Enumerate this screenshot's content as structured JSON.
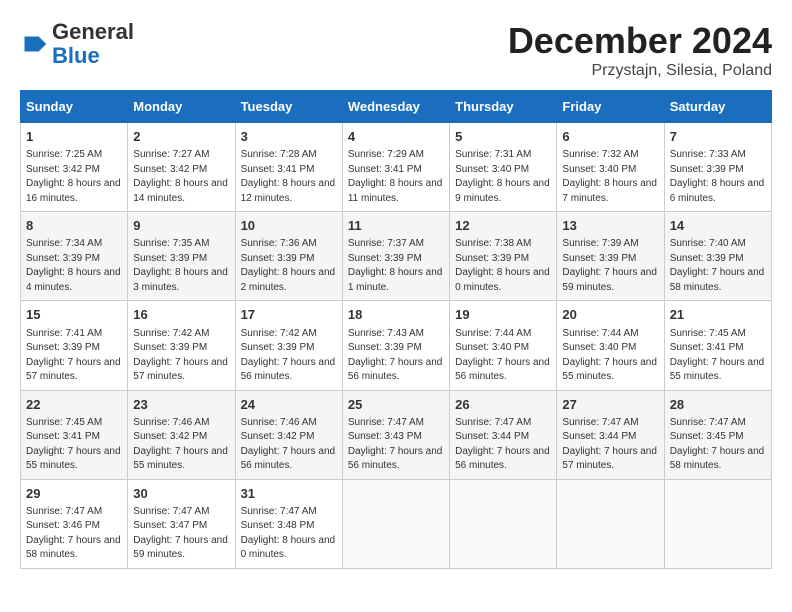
{
  "header": {
    "logo_general": "General",
    "logo_blue": "Blue",
    "month_title": "December 2024",
    "subtitle": "Przystajn, Silesia, Poland"
  },
  "days_of_week": [
    "Sunday",
    "Monday",
    "Tuesday",
    "Wednesday",
    "Thursday",
    "Friday",
    "Saturday"
  ],
  "weeks": [
    [
      {
        "day": "1",
        "sunrise": "7:25 AM",
        "sunset": "3:42 PM",
        "daylight": "8 hours and 16 minutes."
      },
      {
        "day": "2",
        "sunrise": "7:27 AM",
        "sunset": "3:42 PM",
        "daylight": "8 hours and 14 minutes."
      },
      {
        "day": "3",
        "sunrise": "7:28 AM",
        "sunset": "3:41 PM",
        "daylight": "8 hours and 12 minutes."
      },
      {
        "day": "4",
        "sunrise": "7:29 AM",
        "sunset": "3:41 PM",
        "daylight": "8 hours and 11 minutes."
      },
      {
        "day": "5",
        "sunrise": "7:31 AM",
        "sunset": "3:40 PM",
        "daylight": "8 hours and 9 minutes."
      },
      {
        "day": "6",
        "sunrise": "7:32 AM",
        "sunset": "3:40 PM",
        "daylight": "8 hours and 7 minutes."
      },
      {
        "day": "7",
        "sunrise": "7:33 AM",
        "sunset": "3:39 PM",
        "daylight": "8 hours and 6 minutes."
      }
    ],
    [
      {
        "day": "8",
        "sunrise": "7:34 AM",
        "sunset": "3:39 PM",
        "daylight": "8 hours and 4 minutes."
      },
      {
        "day": "9",
        "sunrise": "7:35 AM",
        "sunset": "3:39 PM",
        "daylight": "8 hours and 3 minutes."
      },
      {
        "day": "10",
        "sunrise": "7:36 AM",
        "sunset": "3:39 PM",
        "daylight": "8 hours and 2 minutes."
      },
      {
        "day": "11",
        "sunrise": "7:37 AM",
        "sunset": "3:39 PM",
        "daylight": "8 hours and 1 minute."
      },
      {
        "day": "12",
        "sunrise": "7:38 AM",
        "sunset": "3:39 PM",
        "daylight": "8 hours and 0 minutes."
      },
      {
        "day": "13",
        "sunrise": "7:39 AM",
        "sunset": "3:39 PM",
        "daylight": "7 hours and 59 minutes."
      },
      {
        "day": "14",
        "sunrise": "7:40 AM",
        "sunset": "3:39 PM",
        "daylight": "7 hours and 58 minutes."
      }
    ],
    [
      {
        "day": "15",
        "sunrise": "7:41 AM",
        "sunset": "3:39 PM",
        "daylight": "7 hours and 57 minutes."
      },
      {
        "day": "16",
        "sunrise": "7:42 AM",
        "sunset": "3:39 PM",
        "daylight": "7 hours and 57 minutes."
      },
      {
        "day": "17",
        "sunrise": "7:42 AM",
        "sunset": "3:39 PM",
        "daylight": "7 hours and 56 minutes."
      },
      {
        "day": "18",
        "sunrise": "7:43 AM",
        "sunset": "3:39 PM",
        "daylight": "7 hours and 56 minutes."
      },
      {
        "day": "19",
        "sunrise": "7:44 AM",
        "sunset": "3:40 PM",
        "daylight": "7 hours and 56 minutes."
      },
      {
        "day": "20",
        "sunrise": "7:44 AM",
        "sunset": "3:40 PM",
        "daylight": "7 hours and 55 minutes."
      },
      {
        "day": "21",
        "sunrise": "7:45 AM",
        "sunset": "3:41 PM",
        "daylight": "7 hours and 55 minutes."
      }
    ],
    [
      {
        "day": "22",
        "sunrise": "7:45 AM",
        "sunset": "3:41 PM",
        "daylight": "7 hours and 55 minutes."
      },
      {
        "day": "23",
        "sunrise": "7:46 AM",
        "sunset": "3:42 PM",
        "daylight": "7 hours and 55 minutes."
      },
      {
        "day": "24",
        "sunrise": "7:46 AM",
        "sunset": "3:42 PM",
        "daylight": "7 hours and 56 minutes."
      },
      {
        "day": "25",
        "sunrise": "7:47 AM",
        "sunset": "3:43 PM",
        "daylight": "7 hours and 56 minutes."
      },
      {
        "day": "26",
        "sunrise": "7:47 AM",
        "sunset": "3:44 PM",
        "daylight": "7 hours and 56 minutes."
      },
      {
        "day": "27",
        "sunrise": "7:47 AM",
        "sunset": "3:44 PM",
        "daylight": "7 hours and 57 minutes."
      },
      {
        "day": "28",
        "sunrise": "7:47 AM",
        "sunset": "3:45 PM",
        "daylight": "7 hours and 58 minutes."
      }
    ],
    [
      {
        "day": "29",
        "sunrise": "7:47 AM",
        "sunset": "3:46 PM",
        "daylight": "7 hours and 58 minutes."
      },
      {
        "day": "30",
        "sunrise": "7:47 AM",
        "sunset": "3:47 PM",
        "daylight": "7 hours and 59 minutes."
      },
      {
        "day": "31",
        "sunrise": "7:47 AM",
        "sunset": "3:48 PM",
        "daylight": "8 hours and 0 minutes."
      },
      null,
      null,
      null,
      null
    ]
  ],
  "labels": {
    "sunrise": "Sunrise:",
    "sunset": "Sunset:",
    "daylight": "Daylight:"
  }
}
